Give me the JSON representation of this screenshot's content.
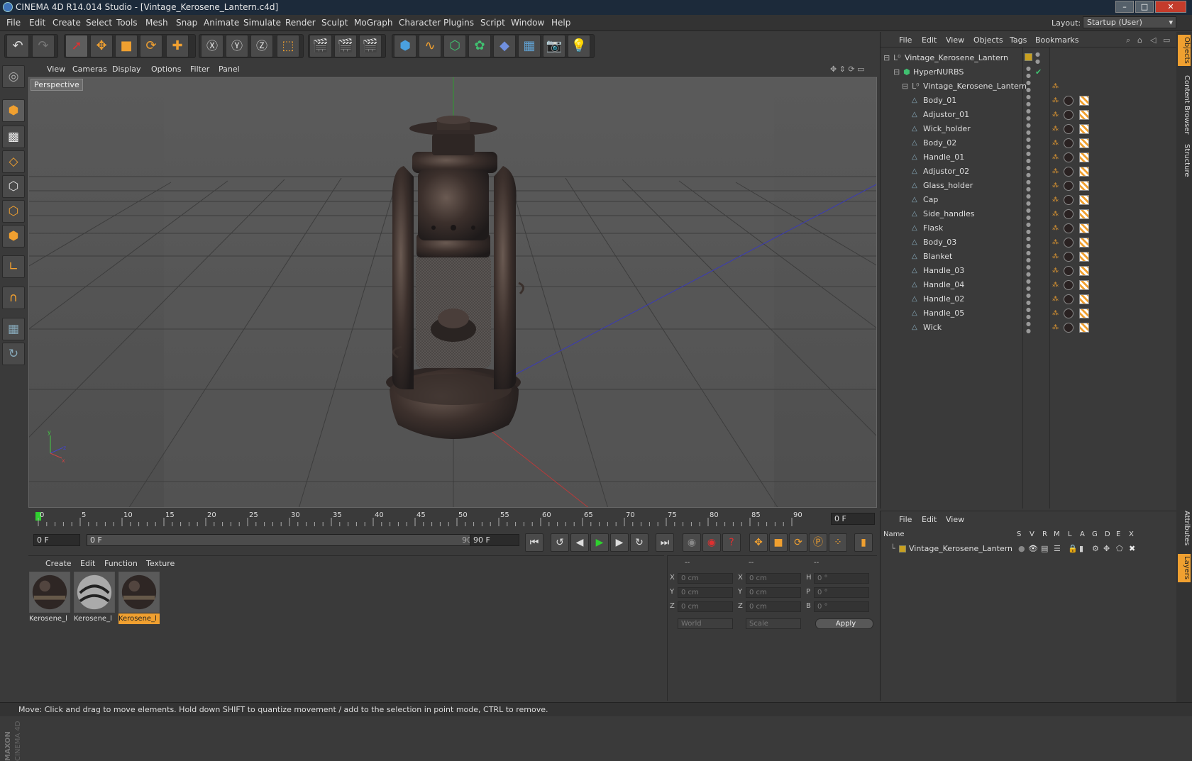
{
  "window": {
    "title": "CINEMA 4D R14.014 Studio - [Vintage_Kerosene_Lantern.c4d]",
    "minimize": "–",
    "maximize": "□",
    "close": "✕"
  },
  "menubar": {
    "items": [
      "File",
      "Edit",
      "Create",
      "Select",
      "Tools",
      "Mesh",
      "Snap",
      "Animate",
      "Simulate",
      "Render",
      "Sculpt",
      "MoGraph",
      "Character",
      "Plugins",
      "Script",
      "Window",
      "Help"
    ],
    "layout_label": "Layout:",
    "layout_value": "Startup (User)"
  },
  "viewport": {
    "menu": [
      "View",
      "Cameras",
      "Display",
      "Options",
      "Filter",
      "Panel"
    ],
    "camera_label": "Perspective"
  },
  "timeline": {
    "ticks": [
      "0",
      "5",
      "10",
      "15",
      "20",
      "25",
      "30",
      "35",
      "40",
      "45",
      "50",
      "55",
      "60",
      "65",
      "70",
      "75",
      "80",
      "85",
      "90"
    ],
    "current_frame": "0 F"
  },
  "transport": {
    "start_field": "0 F",
    "range_start": "0 F",
    "range_end": "90 F",
    "end_field": "90 F"
  },
  "material_manager": {
    "menu": [
      "Create",
      "Edit",
      "Function",
      "Texture"
    ],
    "materials": [
      {
        "name": "Kerosene_l",
        "selected": false
      },
      {
        "name": "Kerosene_l",
        "selected": false
      },
      {
        "name": "Kerosene_l",
        "selected": true
      }
    ]
  },
  "coordinates": {
    "headers": [
      "--",
      "--",
      "--"
    ],
    "rows": [
      {
        "a": "X",
        "av": "0 cm",
        "b": "X",
        "bv": "0 cm",
        "c": "H",
        "cv": "0 °"
      },
      {
        "a": "Y",
        "av": "0 cm",
        "b": "Y",
        "bv": "0 cm",
        "c": "P",
        "cv": "0 °"
      },
      {
        "a": "Z",
        "av": "0 cm",
        "b": "Z",
        "bv": "0 cm",
        "c": "B",
        "cv": "0 °"
      }
    ],
    "space": "World",
    "mode": "Scale",
    "apply": "Apply"
  },
  "object_manager": {
    "menu": [
      "File",
      "Edit",
      "View",
      "Objects",
      "Tags",
      "Bookmarks"
    ],
    "root": "Vintage_Kerosene_Lantern",
    "hypernurbs": "HyperNURBS",
    "group": "Vintage_Kerosene_Lantern",
    "children": [
      "Body_01",
      "Adjustor_01",
      "Wick_holder",
      "Body_02",
      "Handle_01",
      "Adjustor_02",
      "Glass_holder",
      "Cap",
      "Side_handles",
      "Flask",
      "Body_03",
      "Blanket",
      "Handle_03",
      "Handle_04",
      "Handle_02",
      "Handle_05",
      "Wick"
    ]
  },
  "layer_manager": {
    "menu": [
      "File",
      "Edit",
      "View"
    ],
    "columns": [
      "Name",
      "S",
      "V",
      "R",
      "M",
      "L",
      "A",
      "G",
      "D",
      "E",
      "X"
    ],
    "layer": "Vintage_Kerosene_Lantern"
  },
  "side_tabs": [
    "Objects",
    "Content Browser",
    "Structure",
    "Attributes",
    "Layers"
  ],
  "status": "Move: Click and drag to move elements. Hold down SHIFT to quantize movement / add to the selection in point mode, CTRL to remove.",
  "branding": "MAXON CINEMA 4D",
  "colors": {
    "accent": "#f0a030",
    "selected_material": "#f0a030"
  }
}
